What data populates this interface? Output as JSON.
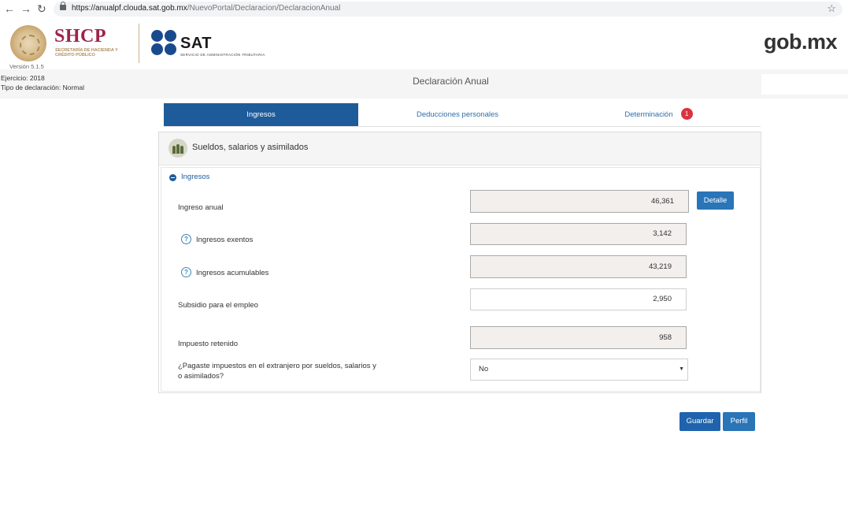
{
  "browser": {
    "url_host": "https://anualpf.clouda.sat.gob.mx",
    "url_path": "/NuevoPortal/Declaracion/DeclaracionAnual"
  },
  "header": {
    "shcp": "SHCP",
    "shcp_sub": "SECRETARÍA DE HACIENDA Y CRÉDITO PÚBLICO",
    "version": "Versión 5.1.5",
    "sat": "SAT",
    "sat_sub": "SERVICIO DE ADMINISTRACIÓN TRIBUTARIA",
    "gobmx": "gob.mx"
  },
  "info": {
    "ejercicio": "Ejercicio: 2018",
    "tipo": "Tipo de declaración: Normal",
    "title": "Declaración Anual"
  },
  "tabs": {
    "ingresos": "Ingresos",
    "deducciones": "Deducciones personales",
    "determinacion": "Determinación",
    "determinacion_badge": "1"
  },
  "panel": {
    "title": "Sueldos, salarios y asimilados",
    "section": "Ingresos",
    "rows": {
      "ingreso_anual": {
        "label": "Ingreso anual",
        "value": "46,361"
      },
      "exentos": {
        "label": "Ingresos exentos",
        "value": "3,142"
      },
      "acumulables": {
        "label": "Ingresos acumulables",
        "value": "43,219"
      },
      "subsidio": {
        "label": "Subsidio para el empleo",
        "value": "2,950"
      },
      "impuesto": {
        "label": "Impuesto retenido",
        "value": "958"
      },
      "extranjero": {
        "label_line1": "¿Pagaste impuestos en el extranjero por sueldos, salarios y",
        "label_line2": "o asimilados?",
        "value": "No"
      }
    },
    "detalle_button": "Detalle"
  },
  "actions": {
    "guardar": "Guardar",
    "perfil": "Perfil"
  },
  "icons": {
    "help": "?",
    "caret": "▼",
    "star": "☆",
    "back": "←",
    "forward": "→",
    "reload": "↻"
  },
  "colors": {
    "primary": "#1e5b9a",
    "button": "#2a74b8",
    "shcp": "#9d2449",
    "badge": "#d9333f"
  }
}
